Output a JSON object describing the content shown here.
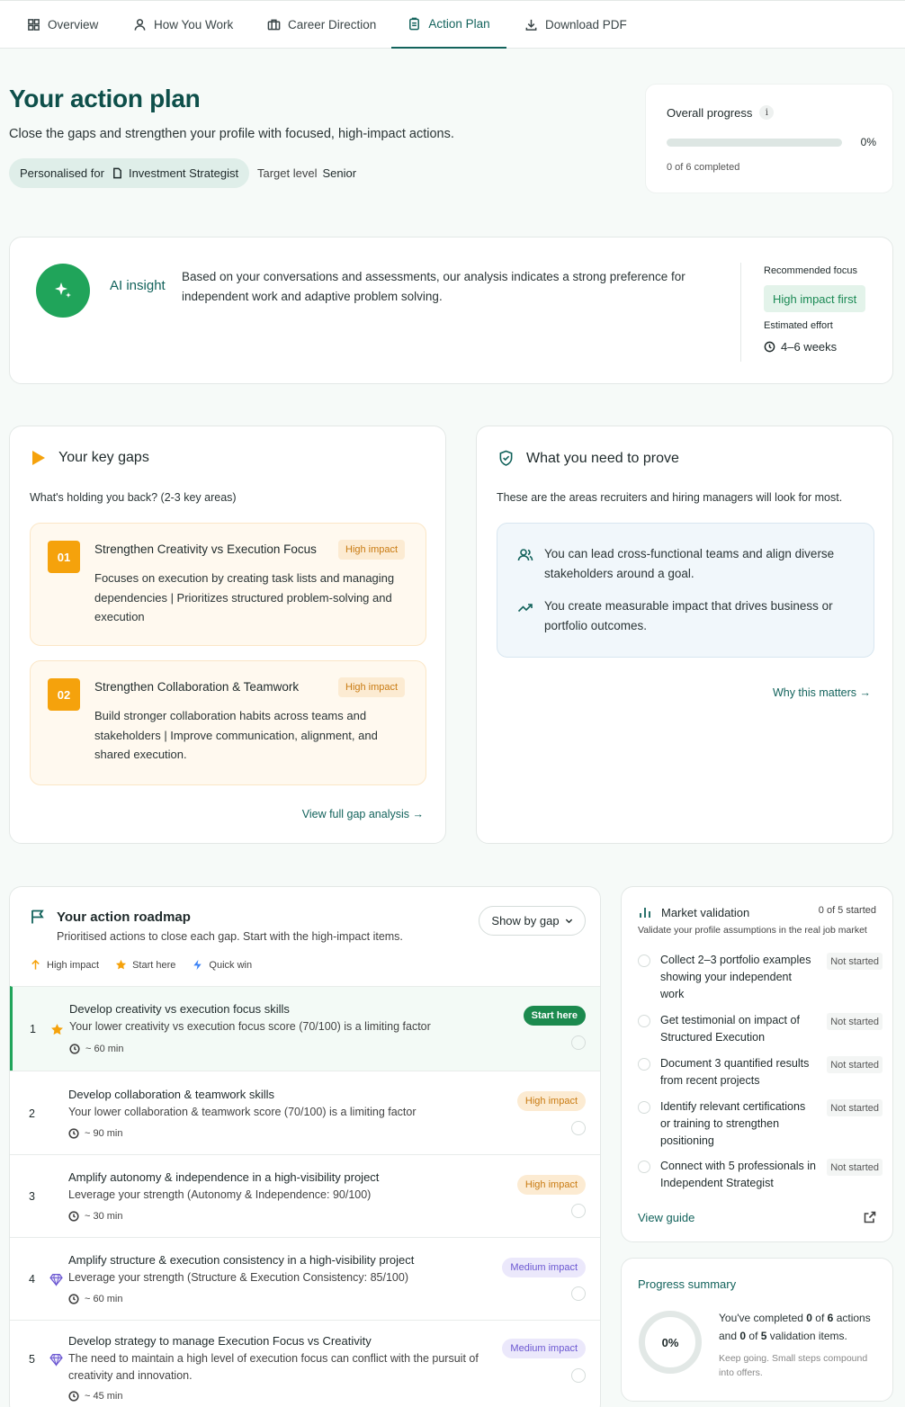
{
  "tabs": [
    {
      "label": "Overview",
      "icon": "grid-icon"
    },
    {
      "label": "How You Work",
      "icon": "person-icon"
    },
    {
      "label": "Career Direction",
      "icon": "briefcase-icon"
    },
    {
      "label": "Action Plan",
      "icon": "clipboard-icon",
      "active": true
    },
    {
      "label": "Download PDF",
      "icon": "download-icon"
    }
  ],
  "header": {
    "title": "Your action plan",
    "subtitle": "Close the gaps and strengthen your profile with focused, high-impact actions.",
    "personalised_prefix": "Personalised for",
    "role": "Investment Strategist",
    "target_label": "Target level",
    "target_value": "Senior"
  },
  "overall_progress": {
    "label": "Overall progress",
    "info": "i",
    "percent_text": "0%",
    "percent": 0,
    "count_text": "0 of 6 completed"
  },
  "ai_insight": {
    "label": "AI insight",
    "text": "Based on your conversations and assessments, our analysis indicates a strong preference for independent work and adaptive problem solving.",
    "recommended_label": "Recommended focus",
    "recommended_value": "High impact first",
    "effort_label": "Estimated effort",
    "effort_value": "4–6 weeks"
  },
  "key_gaps": {
    "title": "Your key gaps",
    "subtitle": "What's holding you back? (2-3 key areas)",
    "items": [
      {
        "num": "01",
        "title": "Strengthen Creativity vs Execution Focus",
        "badge": "High impact",
        "desc": "Focuses on execution by creating task lists and managing dependencies | Prioritizes structured problem-solving and execution"
      },
      {
        "num": "02",
        "title": "Strengthen Collaboration & Teamwork",
        "badge": "High impact",
        "desc": "Build stronger collaboration habits across teams and stakeholders | Improve communication, alignment, and shared execution."
      }
    ],
    "link": "View full gap analysis →"
  },
  "prove": {
    "title": "What you need to prove",
    "subtitle": "These are the areas recruiters and hiring managers will look for most.",
    "items": [
      {
        "icon": "people-icon",
        "text": "You can lead cross-functional teams and align diverse stakeholders around a goal."
      },
      {
        "icon": "trend-up-icon",
        "text": "You create measurable impact that drives business or portfolio outcomes."
      }
    ],
    "link": "Why this matters →"
  },
  "roadmap": {
    "title": "Your action roadmap",
    "subtitle": "Prioritised actions to close each gap. Start with the high-impact items.",
    "show_by": "Show by gap",
    "legend": {
      "high": "High impact",
      "start": "Start here",
      "quick": "Quick win"
    },
    "items": [
      {
        "num": "1",
        "title": "Develop creativity vs execution focus skills",
        "desc": "Your lower creativity vs execution focus score (70/100) is a limiting factor",
        "time": "~ 60 min",
        "badge": "Start here",
        "icon": "star-icon"
      },
      {
        "num": "2",
        "title": "Develop collaboration & teamwork skills",
        "desc": "Your lower collaboration & teamwork score (70/100) is a limiting factor",
        "time": "~ 90 min",
        "badge": "High impact",
        "icon": ""
      },
      {
        "num": "3",
        "title": "Amplify autonomy & independence in a high-visibility project",
        "desc": "Leverage your strength (Autonomy & Independence: 90/100)",
        "time": "~ 30 min",
        "badge": "High impact",
        "icon": ""
      },
      {
        "num": "4",
        "title": "Amplify structure & execution consistency in a high-visibility project",
        "desc": "Leverage your strength (Structure & Execution Consistency: 85/100)",
        "time": "~ 60 min",
        "badge": "Medium impact",
        "icon": "gem-icon"
      },
      {
        "num": "5",
        "title": "Develop strategy to manage Execution Focus vs Creativity",
        "desc": "The need to maintain a high level of execution focus can conflict with the pursuit of creativity and innovation.",
        "time": "~ 45 min",
        "badge": "Medium impact",
        "icon": "gem-icon"
      }
    ]
  },
  "market_validation": {
    "title": "Market validation",
    "started": "0 of 5 started",
    "subtitle": "Validate your profile assumptions in the real job market",
    "items": [
      {
        "text": "Collect 2–3 portfolio examples showing your independent work",
        "status": "Not started"
      },
      {
        "text": "Get testimonial on impact of Structured Execution",
        "status": "Not started"
      },
      {
        "text": "Document 3 quantified results from recent projects",
        "status": "Not started"
      },
      {
        "text": "Identify relevant certifications or training to strengthen positioning",
        "status": "Not started"
      },
      {
        "text": "Connect with 5 professionals in Independent Strategist",
        "status": "Not started"
      }
    ],
    "guide": "View guide"
  },
  "progress_summary": {
    "title": "Progress summary",
    "percent_text": "0%",
    "line_a": "You've completed",
    "done_actions": "0",
    "line_b": "of",
    "total_actions": "6",
    "line_c": "actions and",
    "done_validation": "0",
    "line_d": "of",
    "total_validation": "5",
    "line_e": "validation items.",
    "note": "Keep going. Small steps compound into offers."
  },
  "colors": {
    "brand": "#13635c",
    "accent_green": "#20a45a",
    "gap_orange": "#f5a20c",
    "medium_purple": "#6b57d1"
  }
}
